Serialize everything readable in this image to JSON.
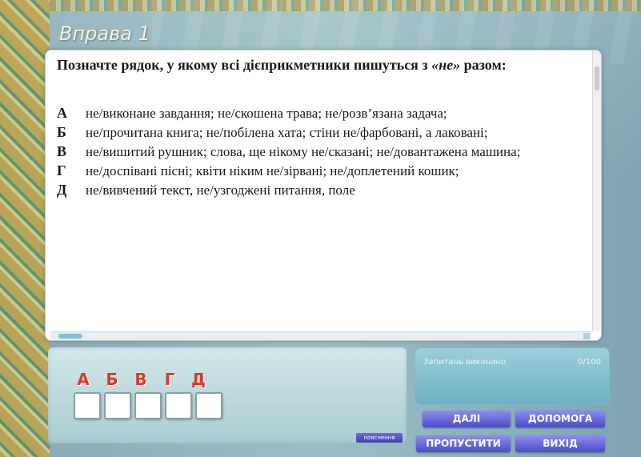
{
  "header": {
    "title": "Вправа 1"
  },
  "question": {
    "prompt_part1": "Позначте рядок, у якому всі дієприкметники пишуться з ",
    "prompt_em": "«не»",
    "prompt_part2": " разом:"
  },
  "options": [
    {
      "letter": "А",
      "text": "не/виконане завдання; не/скошена трава; не/розв’язана задача;"
    },
    {
      "letter": "Б",
      "text": "не/прочитана книга; не/побілена хата; стіни не/фарбовані, а лаковані;"
    },
    {
      "letter": "В",
      "text": "не/вишитий рушник; слова, ще нікому не/сказані; не/довантажена машина;"
    },
    {
      "letter": "Г",
      "text": "не/доспівані пісні; квіти ніким не/зірвані; не/доплетений кошик;"
    },
    {
      "letter": "Д",
      "text": "не/вивчений текст, не/узгоджені питання, поле"
    }
  ],
  "answer_letters": [
    "А",
    "Б",
    "В",
    "Г",
    "Д"
  ],
  "explain_label": "пояснення",
  "status": {
    "label": "Запитань виконано",
    "count": "0/100"
  },
  "buttons": {
    "next": "ДАЛІ",
    "help": "ДОПОМОГА",
    "skip": "ПРОПУСТИТИ",
    "exit": "ВИХІД"
  }
}
